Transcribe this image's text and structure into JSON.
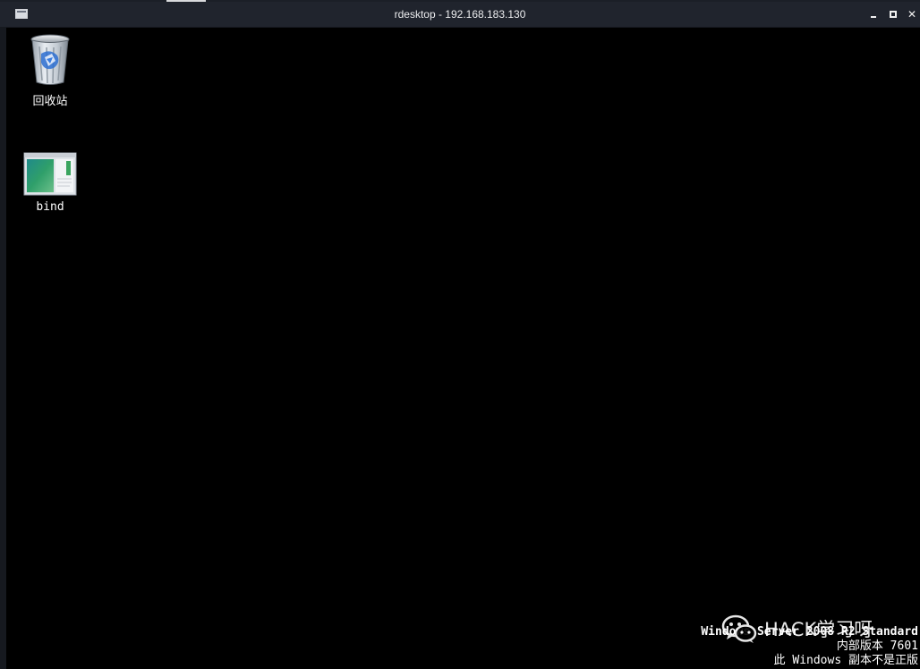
{
  "window": {
    "title": "rdesktop - 192.168.183.130",
    "controls": [
      "minimize",
      "maximize",
      "close"
    ],
    "close_glyph": "✕"
  },
  "desktop": {
    "background": "#000000",
    "icons": [
      {
        "label": "回收站",
        "icon": "recycle-bin-icon"
      },
      {
        "label": "bind",
        "icon": "application-window-icon"
      }
    ]
  },
  "watermark": {
    "line1": "Windows Server 2008 R2 Standard",
    "line2": "内部版本 7601",
    "line3": "此 Windows 副本不是正版"
  },
  "overlay": {
    "text": "HACK学习呀",
    "icon": "wechat-icon"
  }
}
